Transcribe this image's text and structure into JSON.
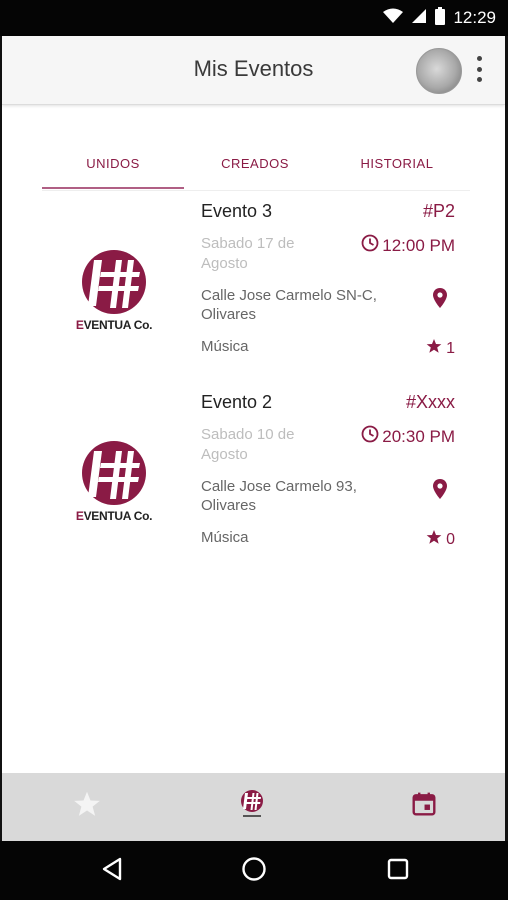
{
  "status_bar": {
    "time": "12:29"
  },
  "app_bar": {
    "title": "Mis Eventos"
  },
  "tabs": [
    {
      "label": "UNIDOS",
      "active": true
    },
    {
      "label": "CREADOS",
      "active": false
    },
    {
      "label": "HISTORIAL",
      "active": false
    }
  ],
  "events": [
    {
      "logo_text_first": "E",
      "logo_text_rest": "VENTUA Co.",
      "title": "Evento 3",
      "code": "#P2",
      "date": "Sabado 17 de Agosto",
      "time": "12:00 PM",
      "address": "Calle Jose Carmelo SN-C, Olivares",
      "category": "Música",
      "rating": "1"
    },
    {
      "logo_text_first": "E",
      "logo_text_rest": "VENTUA Co.",
      "title": "Evento 2",
      "code": "#Xxxx",
      "date": "Sabado 10 de Agosto",
      "time": "20:30 PM",
      "address": "Calle Jose Carmelo 93, Olivares",
      "category": "Música",
      "rating": "0"
    }
  ],
  "bottom_nav": [
    {
      "icon": "star-icon"
    },
    {
      "icon": "eventua-logo-icon"
    },
    {
      "icon": "calendar-icon"
    }
  ],
  "colors": {
    "accent": "#8a1b45",
    "tab_indicator": "#b05f84",
    "bottom_nav_bg": "#d9d9d9"
  }
}
